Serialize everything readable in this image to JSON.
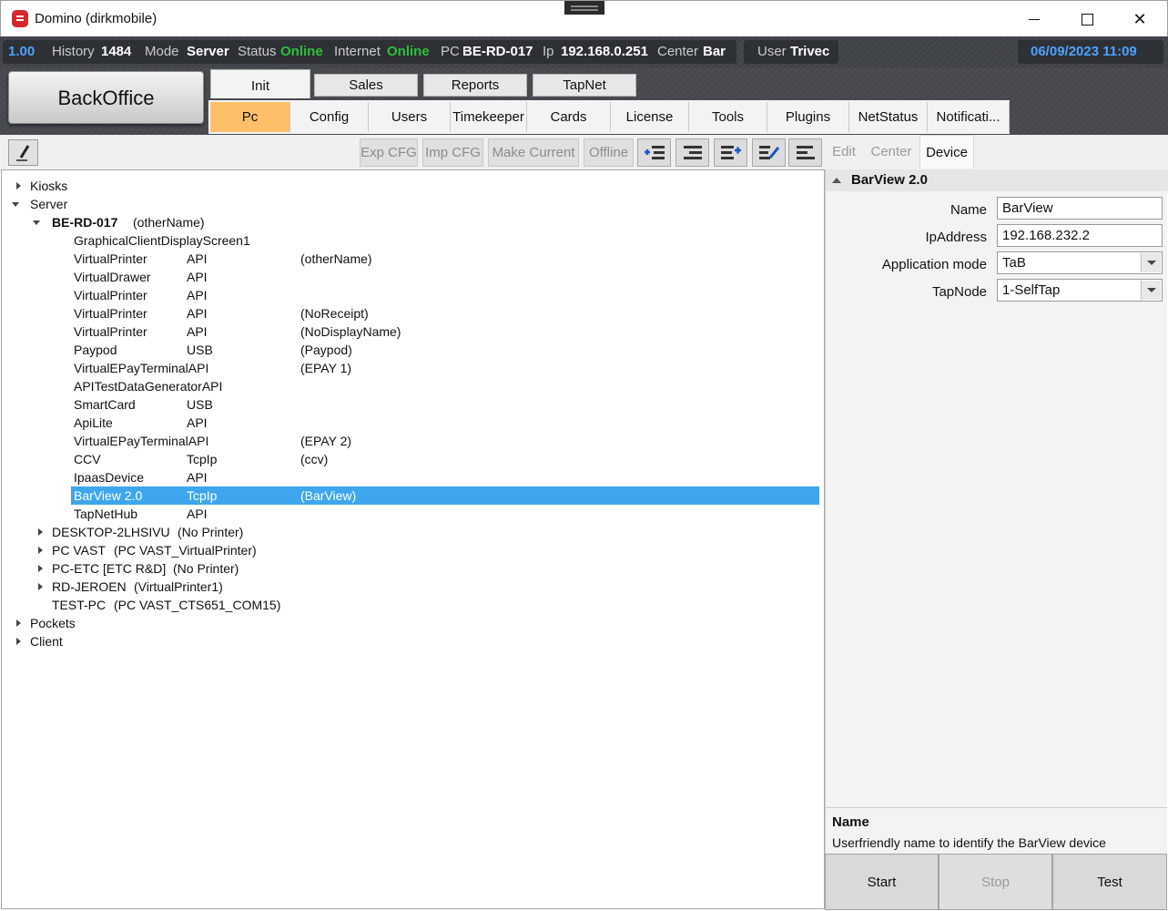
{
  "window": {
    "title": "Domino (dirkmobile)"
  },
  "status": {
    "version": "1.00",
    "history_label": "History",
    "history_value": "1484",
    "mode_label": "Mode",
    "mode_value": "Server",
    "status_label": "Status",
    "status_value": "Online",
    "internet_label": "Internet",
    "internet_value": "Online",
    "pc_label": "PC",
    "pc_value": "BE-RD-017",
    "ip_label": "Ip",
    "ip_value": "192.168.0.251",
    "center_label": "Center",
    "center_value": "Bar",
    "user_label": "User",
    "user_value": "Trivec",
    "datetime": "06/09/2023 11:09"
  },
  "backoffice_label": "BackOffice",
  "main_tabs": [
    {
      "label": "Init"
    },
    {
      "label": "Sales"
    },
    {
      "label": "Reports"
    },
    {
      "label": "TapNet"
    }
  ],
  "sub_tabs": [
    {
      "label": "Pc"
    },
    {
      "label": "Config"
    },
    {
      "label": "Users"
    },
    {
      "label": "Timekeeper"
    },
    {
      "label": "Cards"
    },
    {
      "label": "License"
    },
    {
      "label": "Tools"
    },
    {
      "label": "Plugins"
    },
    {
      "label": "NetStatus"
    },
    {
      "label": "Notificati..."
    }
  ],
  "toolbar": {
    "exp_cfg": "Exp CFG",
    "imp_cfg": "Imp CFG",
    "make_current": "Make Current",
    "offline": "Offline"
  },
  "right_tabs": {
    "edit": "Edit",
    "center": "Center",
    "device": "Device"
  },
  "tree": {
    "kiosks": "Kiosks",
    "server": "Server",
    "pc_node": {
      "name": "BE-RD-017",
      "extra": "(otherName)"
    },
    "devices": [
      {
        "name": "GraphicalClientDisplayScreen1",
        "type": "",
        "extra": ""
      },
      {
        "name": "VirtualPrinter",
        "type": "API",
        "extra": "(otherName)"
      },
      {
        "name": "VirtualDrawer",
        "type": "API",
        "extra": ""
      },
      {
        "name": "VirtualPrinter",
        "type": "API",
        "extra": ""
      },
      {
        "name": "VirtualPrinter",
        "type": "API",
        "extra": "(NoReceipt)"
      },
      {
        "name": "VirtualPrinter",
        "type": "API",
        "extra": "(NoDisplayName)"
      },
      {
        "name": "Paypod",
        "type": "USB",
        "extra": "(Paypod)"
      },
      {
        "name": "VirtualEPayTerminalAPI",
        "type": "",
        "extra": " (EPAY 1)"
      },
      {
        "name": "APITestDataGeneratorAPI",
        "type": "",
        "extra": ""
      },
      {
        "name": "SmartCard",
        "type": "USB",
        "extra": ""
      },
      {
        "name": "ApiLite",
        "type": "API",
        "extra": ""
      },
      {
        "name": "VirtualEPayTerminalAPI",
        "type": "",
        "extra": " (EPAY 2)"
      },
      {
        "name": "CCV",
        "type": "TcpIp",
        "extra": "(ccv)"
      },
      {
        "name": "IpaasDevice",
        "type": "API",
        "extra": ""
      },
      {
        "name": "BarView 2.0",
        "type": "TcpIp",
        "extra": "(BarView)"
      },
      {
        "name": "TapNetHub",
        "type": "API",
        "extra": ""
      }
    ],
    "other_pcs": [
      {
        "name": "DESKTOP-2LHSIVU",
        "extra": "(No Printer)"
      },
      {
        "name": "PC VAST",
        "extra": "(PC VAST_VirtualPrinter)"
      },
      {
        "name": "PC-ETC [ETC R&D]",
        "extra": "(No Printer)"
      },
      {
        "name": "RD-JEROEN",
        "extra": "(VirtualPrinter1)"
      },
      {
        "name": "TEST-PC",
        "extra": "(PC VAST_CTS651_COM15)"
      }
    ],
    "pockets": "Pockets",
    "client": "Client"
  },
  "properties": {
    "category": "BarView 2.0",
    "rows": [
      {
        "label": "Name",
        "value": "BarView"
      },
      {
        "label": "IpAddress",
        "value": "192.168.232.2"
      },
      {
        "label": "Application mode",
        "value": "TaB"
      },
      {
        "label": "TapNode",
        "value": "1-SelfTap"
      }
    ],
    "description_title": "Name",
    "description_text": "Userfriendly name to identify the BarView device"
  },
  "actions": {
    "start": "Start",
    "stop": "Stop",
    "test": "Test"
  }
}
